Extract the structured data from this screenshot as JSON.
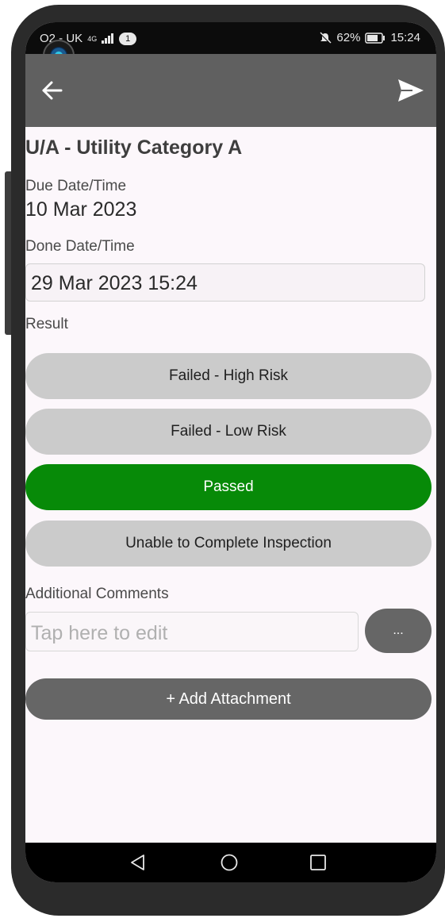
{
  "status_bar": {
    "carrier": "O2 - UK",
    "network": "4G",
    "sim_badge": "1",
    "battery": "62%",
    "time": "15:24"
  },
  "toolbar": {
    "back_icon": "arrow-left-icon",
    "send_icon": "send-icon"
  },
  "form": {
    "title": "U/A - Utility Category A",
    "due_label": "Due Date/Time",
    "due_value": "10 Mar 2023",
    "done_label": "Done Date/Time",
    "done_value": "29 Mar 2023 15:24",
    "result_label": "Result",
    "results": [
      {
        "label": "Failed - High Risk",
        "selected": false
      },
      {
        "label": "Failed - Low Risk",
        "selected": false
      },
      {
        "label": "Passed",
        "selected": true
      },
      {
        "label": "Unable to Complete Inspection",
        "selected": false
      }
    ],
    "comments_label": "Additional Comments",
    "comments_placeholder": "Tap here to edit",
    "more_label": "...",
    "add_attachment_label": "+ Add Attachment"
  },
  "colors": {
    "toolbar": "#606060",
    "selected_result": "#078a08",
    "unselected_result": "#cbcbcb",
    "dark_button": "#666666"
  }
}
